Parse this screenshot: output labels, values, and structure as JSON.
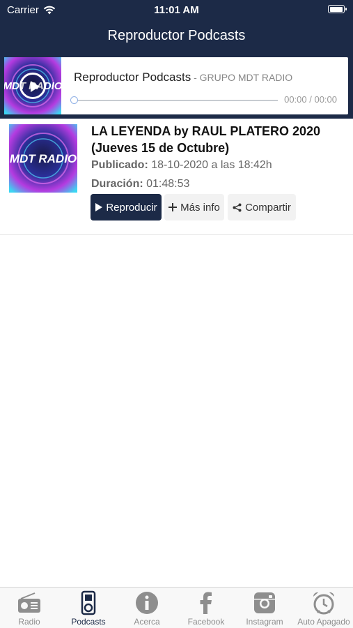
{
  "status_bar": {
    "carrier": "Carrier",
    "time": "11:01 AM",
    "battery_level": 1.0
  },
  "nav": {
    "title": "Reproductor Podcasts"
  },
  "player": {
    "title": "Reproductor Podcasts",
    "separator": " - ",
    "subtitle": "GRUPO MDT RADIO",
    "time": "00:00 / 00:00",
    "progress": 0,
    "artwork": "MDT RADIO"
  },
  "episode": {
    "title": "LA LEYENDA by RAUL PLATERO 2020 (Jueves 15 de Octubre)",
    "published_label": "Publicado:",
    "published_value": "18-10-2020 a las 18:42h",
    "duration_label": "Duración:",
    "duration_value": "01:48:53",
    "artwork": "MDT RADIO",
    "buttons": {
      "play": "Reproducir",
      "info": "Más info",
      "share": "Compartir"
    }
  },
  "tabs": [
    {
      "label": "Radio",
      "icon": "radio-icon"
    },
    {
      "label": "Podcasts",
      "icon": "ipod-icon",
      "active": true
    },
    {
      "label": "Acerca",
      "icon": "info-icon"
    },
    {
      "label": "Facebook",
      "icon": "facebook-icon"
    },
    {
      "label": "Instagram",
      "icon": "instagram-icon"
    },
    {
      "label": "Auto Apagado",
      "icon": "alarm-clock-icon"
    }
  ],
  "colors": {
    "primary": "#1c2a47",
    "tab_inactive": "#8e8e8e",
    "background": "#ffffff"
  }
}
